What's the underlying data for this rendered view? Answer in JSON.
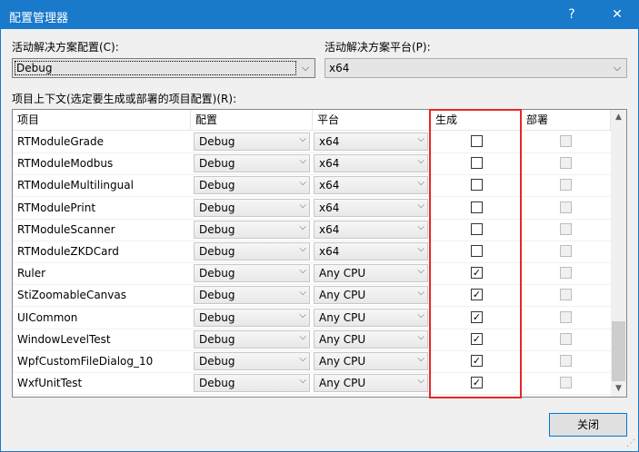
{
  "window": {
    "title": "配置管理器",
    "help_label": "?",
    "close_label": "✕"
  },
  "active_config": {
    "label": "活动解决方案配置(C):",
    "value": "Debug"
  },
  "active_platform": {
    "label": "活动解决方案平台(P):",
    "value": "x64"
  },
  "grid_label": "项目上下文(选定要生成或部署的项目配置)(R):",
  "columns": {
    "project": "项目",
    "config": "配置",
    "platform": "平台",
    "build": "生成",
    "deploy": "部署"
  },
  "rows": [
    {
      "project": "RTModuleGrade",
      "config": "Debug",
      "platform": "x64",
      "build": false
    },
    {
      "project": "RTModuleModbus",
      "config": "Debug",
      "platform": "x64",
      "build": false
    },
    {
      "project": "RTModuleMultilingual",
      "config": "Debug",
      "platform": "x64",
      "build": false
    },
    {
      "project": "RTModulePrint",
      "config": "Debug",
      "platform": "x64",
      "build": false
    },
    {
      "project": "RTModuleScanner",
      "config": "Debug",
      "platform": "x64",
      "build": false
    },
    {
      "project": "RTModuleZKDCard",
      "config": "Debug",
      "platform": "x64",
      "build": false
    },
    {
      "project": "Ruler",
      "config": "Debug",
      "platform": "Any CPU",
      "build": true
    },
    {
      "project": "StiZoomableCanvas",
      "config": "Debug",
      "platform": "Any CPU",
      "build": true
    },
    {
      "project": "UICommon",
      "config": "Debug",
      "platform": "Any CPU",
      "build": true
    },
    {
      "project": "WindowLevelTest",
      "config": "Debug",
      "platform": "Any CPU",
      "build": true
    },
    {
      "project": "WpfCustomFileDialog_10",
      "config": "Debug",
      "platform": "Any CPU",
      "build": true
    },
    {
      "project": "WxfUnitTest",
      "config": "Debug",
      "platform": "Any CPU",
      "build": true
    }
  ],
  "scroll_position": 1.0,
  "close_button": "关闭",
  "icons": {
    "dropdown": "chevron-down-icon",
    "check": "checkmark-icon"
  },
  "colors": {
    "titlebar": "#1979ca",
    "highlight_box": "#e8262a"
  }
}
